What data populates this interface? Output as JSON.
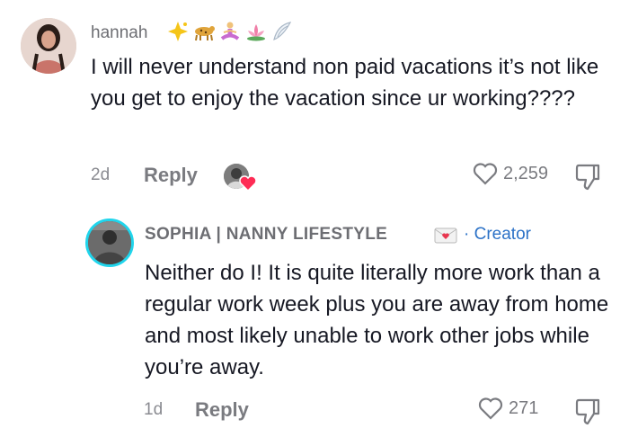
{
  "comment_1": {
    "username": "hannah",
    "text": "I will never understand non paid vacations it’s not like you get to enjoy the vacation since ur working????",
    "age": "2d",
    "reply_label": "Reply",
    "like_count": "2,259",
    "icons": [
      "sparkle-star-icon",
      "leopard-icon",
      "meditation-icon",
      "lotus-icon",
      "wing-icon"
    ]
  },
  "comment_2": {
    "username": "SOPHIA | NANNY LIFESTYLE",
    "creator_label": "· Creator",
    "text": "Neither do I! It is quite literally more work than a regular work week plus you are away from home and most likely unable to work other jobs while you’re away.",
    "age": "1d",
    "reply_label": "Reply",
    "like_count": "271"
  },
  "colors": {
    "creator": "#2c72c7",
    "ring": "#20d5ec",
    "heart": "#fe2c55"
  }
}
